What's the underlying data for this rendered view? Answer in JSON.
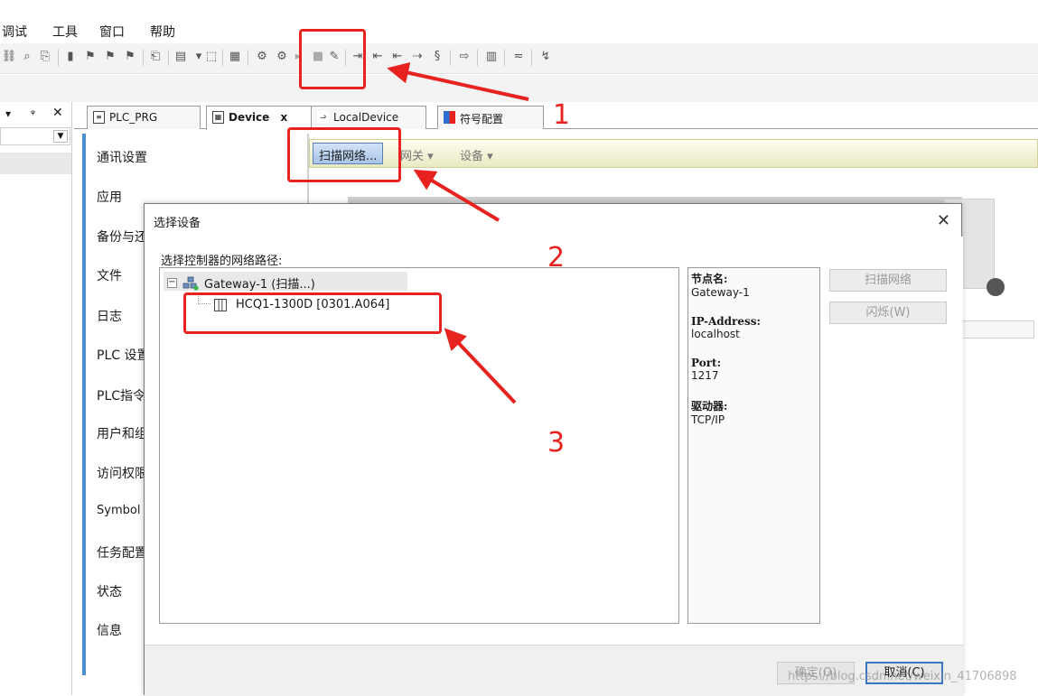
{
  "menu": [
    "调试",
    "工具",
    "窗口",
    "帮助"
  ],
  "tabs": [
    {
      "label": "PLC_PRG"
    },
    {
      "label": "Device",
      "close": "x"
    },
    {
      "label": "LocalDevice"
    },
    {
      "label": "符号配置"
    }
  ],
  "device_nav": [
    "通讯设置",
    "应用",
    "备份与还",
    "文件",
    "日志",
    "PLC 设置",
    "PLC指令",
    "用户和组",
    "访问权限",
    "Symbol R",
    "任务配置",
    "状态",
    "信息"
  ],
  "scan_bar": {
    "scan": "扫描网络...",
    "gateway": "网关 ▾",
    "device": "设备 ▾"
  },
  "dialog": {
    "title": "选择设备",
    "close": "✕",
    "path_label": "选择控制器的网络路径:",
    "tree": {
      "gateway": "Gateway-1 (扫描...)",
      "device": "HCQ1-1300D [0301.A064]"
    },
    "info": [
      {
        "key": "节点名:",
        "value": "Gateway-1"
      },
      {
        "key": "IP-Address:",
        "value": "localhost"
      },
      {
        "key": "Port:",
        "value": "1217"
      },
      {
        "key": "驱动器:",
        "value": "TCP/IP"
      }
    ],
    "buttons": {
      "scan": "扫描网络",
      "blink": "闪烁(W)",
      "ok": "确定(O)",
      "cancel": "取消(C)"
    }
  },
  "annotations": [
    "1",
    "2",
    "3"
  ],
  "watermark": "https://blog.csdn.net/weixin_41706898",
  "colors": {
    "annotation": "#e8231f",
    "accent": "#4a8fd1"
  }
}
